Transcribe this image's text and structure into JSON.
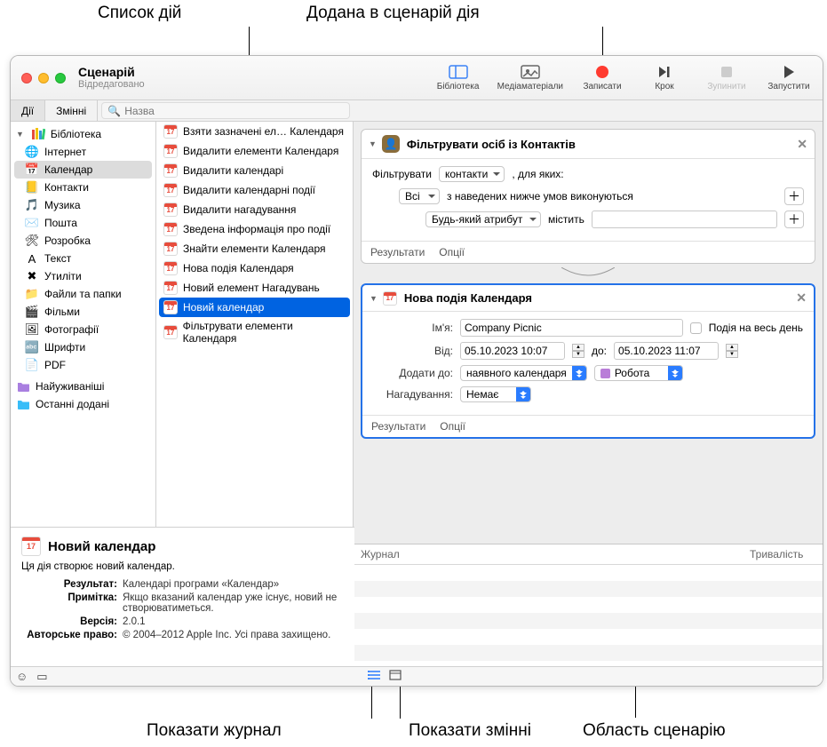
{
  "callouts": {
    "actions_list": "Список дій",
    "added_action": "Додана в сценарій дія",
    "show_log": "Показати журнал",
    "show_vars": "Показати змінні",
    "workflow_area": "Область сценарію"
  },
  "window": {
    "title": "Сценарій",
    "subtitle": "Відредаговано"
  },
  "toolbar": {
    "library": "Бібліотека",
    "media": "Медіаматеріали",
    "record": "Записати",
    "step": "Крок",
    "stop": "Зупинити",
    "run": "Запустити"
  },
  "filter": {
    "actions": "Дії",
    "variables": "Змінні",
    "search_placeholder": "Назва"
  },
  "sidebar": {
    "top": "Бібліотека",
    "items": [
      {
        "label": "Інтернет",
        "icon": "🌐"
      },
      {
        "label": "Календар",
        "icon": "📅",
        "selected": true
      },
      {
        "label": "Контакти",
        "icon": "📒"
      },
      {
        "label": "Музика",
        "icon": "🎵"
      },
      {
        "label": "Пошта",
        "icon": "✉️"
      },
      {
        "label": "Розробка",
        "icon": "🛠"
      },
      {
        "label": "Текст",
        "icon": "A"
      },
      {
        "label": "Утиліти",
        "icon": "✖"
      },
      {
        "label": "Файли та папки",
        "icon": "📁"
      },
      {
        "label": "Фільми",
        "icon": "🎬"
      },
      {
        "label": "Фотографії",
        "icon": "🖼"
      },
      {
        "label": "Шрифти",
        "icon": "🔤"
      },
      {
        "label": "PDF",
        "icon": "📄"
      }
    ],
    "footer": [
      {
        "label": "Найуживаніші",
        "icon": "📁",
        "color": "#a97fe0"
      },
      {
        "label": "Останні додані",
        "icon": "📁",
        "color": "#38bdf8"
      }
    ]
  },
  "actions": [
    "Взяти зазначені ел… Календаря",
    "Видалити елементи Календаря",
    "Видалити календарі",
    "Видалити календарні події",
    "Видалити нагадування",
    "Зведена інформація про події",
    "Знайти елементи Календаря",
    "Нова подія Календаря",
    "Новий елемент Нагадувань",
    "Новий календар",
    "Фільтрувати елементи Календаря"
  ],
  "actions_selected_index": 9,
  "wf1": {
    "title": "Фільтрувати осіб із Контактів",
    "filter_label": "Фільтрувати",
    "filter_select": "контакти",
    "for_which": ", для яких:",
    "all": "Всі",
    "conditions_met": "з наведених нижче умов виконуються",
    "any_attr": "Будь-який атрибут",
    "contains": "містить",
    "results": "Результати",
    "options": "Опції"
  },
  "wf2": {
    "title": "Нова подія Календаря",
    "name_label": "Ім'я:",
    "name_value": "Company Picnic",
    "allday": "Подія на весь день",
    "from_label": "Від:",
    "from_value": "05.10.2023 10:07",
    "to_label": "до:",
    "to_value": "05.10.2023 11:07",
    "addto_label": "Додати до:",
    "addto_value": "наявного календаря",
    "calendar_name": "Робота",
    "reminder_label": "Нагадування:",
    "reminder_value": "Немає",
    "results": "Результати",
    "options": "Опції"
  },
  "log": {
    "journal": "Журнал",
    "duration": "Тривалість"
  },
  "info": {
    "title": "Новий календар",
    "desc": "Ця дія створює новий календар.",
    "result_k": "Результат:",
    "result_v": "Календарі програми «Календар»",
    "note_k": "Примітка:",
    "note_v": "Якщо вказаний календар уже існує, новий не створюватиметься.",
    "version_k": "Версія:",
    "version_v": "2.0.1",
    "copyright_k": "Авторське право:",
    "copyright_v": "© 2004–2012 Apple Inc.  Усі права захищено."
  }
}
